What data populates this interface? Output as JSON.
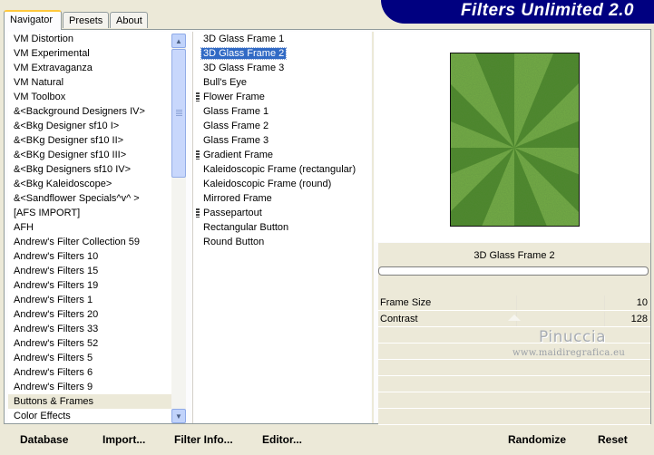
{
  "header": {
    "title": "Filters Unlimited 2.0"
  },
  "tabs": [
    {
      "label": "Navigator",
      "active": true
    },
    {
      "label": "Presets",
      "active": false
    },
    {
      "label": "About",
      "active": false
    }
  ],
  "categories": {
    "items": [
      "VM Distortion",
      "VM Experimental",
      "VM Extravaganza",
      "VM Natural",
      "VM Toolbox",
      "&<Background Designers IV>",
      "&<Bkg Designer sf10 I>",
      "&<BKg Designer sf10 II>",
      "&<BKg Designer sf10 III>",
      "&<Bkg Designers sf10 IV>",
      "&<Bkg Kaleidoscope>",
      "&<Sandflower Specials^v^ >",
      "[AFS IMPORT]",
      "AFH",
      "Andrew's Filter Collection 59",
      "Andrew's Filters 10",
      "Andrew's Filters 15",
      "Andrew's Filters 19",
      "Andrew's Filters 1",
      "Andrew's Filters 20",
      "Andrew's Filters 33",
      "Andrew's Filters 52",
      "Andrew's Filters 5",
      "Andrew's Filters 6",
      "Andrew's Filters 9",
      "Buttons & Frames",
      "Color Effects"
    ],
    "selected": "Buttons & Frames"
  },
  "filters": {
    "items": [
      {
        "label": "3D Glass Frame 1",
        "marked": false
      },
      {
        "label": "3D Glass Frame 2",
        "marked": false
      },
      {
        "label": "3D Glass Frame 3",
        "marked": false
      },
      {
        "label": "Bull's Eye",
        "marked": false
      },
      {
        "label": "Flower Frame",
        "marked": true
      },
      {
        "label": "Glass Frame 1",
        "marked": false
      },
      {
        "label": "Glass Frame 2",
        "marked": false
      },
      {
        "label": "Glass Frame 3",
        "marked": false
      },
      {
        "label": "Gradient Frame",
        "marked": true
      },
      {
        "label": "Kaleidoscopic Frame (rectangular)",
        "marked": false
      },
      {
        "label": "Kaleidoscopic Frame (round)",
        "marked": false
      },
      {
        "label": "Mirrored Frame",
        "marked": false
      },
      {
        "label": "Passepartout",
        "marked": true
      },
      {
        "label": "Rectangular Button",
        "marked": false
      },
      {
        "label": "Round Button",
        "marked": false
      }
    ],
    "selected": "3D Glass Frame 2"
  },
  "preview": {
    "filter_name": "3D Glass Frame 2",
    "progress": 0
  },
  "parameters": [
    {
      "label": "Frame Size",
      "value": "10",
      "level": 0.04
    },
    {
      "label": "Contrast",
      "value": "128",
      "level": 0.5
    }
  ],
  "watermark": {
    "name": "Pinuccia",
    "url": "www.maidiregrafica.eu"
  },
  "buttons": {
    "database": "Database",
    "import": "Import...",
    "filter_info": "Filter Info...",
    "editor": "Editor...",
    "randomize": "Randomize",
    "reset": "Reset"
  },
  "colors": {
    "banner": "#000080",
    "selection": "#316ac5",
    "preview_green": "#4d8a2a"
  }
}
